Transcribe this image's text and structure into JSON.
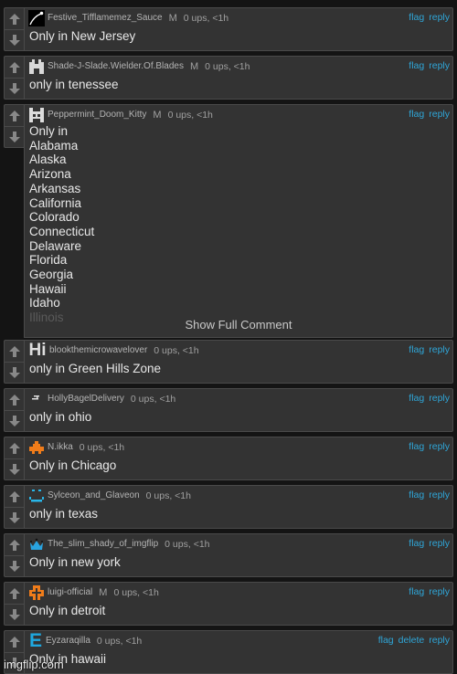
{
  "colors": {
    "link": "#2fa6d8",
    "background": "#141414",
    "card": "#333333"
  },
  "comments": [
    {
      "user": "Festive_Tifflamemez_Sauce",
      "mod": "M",
      "meta": "0 ups, <1h",
      "text": "Only in New Jersey",
      "avatar": "shooting-star-avatar",
      "actions": [
        "flag",
        "reply"
      ]
    },
    {
      "user": "Shade-J-Slade.Wielder.Of.Blades",
      "mod": "M",
      "meta": "0 ups, <1h",
      "text": "only in tenessee",
      "avatar": "floppy-disk-avatar",
      "actions": [
        "flag",
        "reply"
      ]
    },
    {
      "user": "Peppermint_Doom_Kitty",
      "mod": "M",
      "meta": "0 ups, <1h",
      "lines": [
        "Only in",
        "Alabama",
        "Alaska",
        "Arizona",
        "Arkansas",
        "California",
        "Colorado",
        "Connecticut",
        "Delaware",
        "Florida",
        "Georgia",
        "Hawaii",
        "Idaho"
      ],
      "faded_line": "Illinois",
      "show_full": "Show Full Comment",
      "avatar": "pixel-cat-avatar",
      "actions": [
        "flag",
        "reply"
      ]
    },
    {
      "user": "blookthemicrowavelover",
      "meta": "0 ups, <1h",
      "text": "only in Green Hills Zone",
      "avatar": "hi-text-avatar",
      "avatar_text": "Hi",
      "actions": [
        "flag",
        "reply"
      ]
    },
    {
      "user": "HollyBagelDelivery",
      "meta": "0 ups, <1h",
      "text": "only in ohio",
      "avatar": "small-glyph-avatar",
      "actions": [
        "flag",
        "reply"
      ]
    },
    {
      "user": "N.ikka",
      "meta": "0 ups, <1h",
      "text": "Only in Chicago",
      "avatar": "orange-pixel-avatar",
      "actions": [
        "flag",
        "reply"
      ]
    },
    {
      "user": "Sylceon_and_Glaveon",
      "meta": "0 ups, <1h",
      "text": "only in texas",
      "avatar": "blue-smiley-avatar",
      "actions": [
        "flag",
        "reply"
      ]
    },
    {
      "user": "The_slim_shady_of_imgflip",
      "meta": "0 ups, <1h",
      "text": "Only in new york",
      "avatar": "blue-crown-avatar",
      "actions": [
        "flag",
        "reply"
      ]
    },
    {
      "user": "luigi-official",
      "mod": "M",
      "meta": "0 ups, <1h",
      "text": "Only in detroit",
      "avatar": "orange-block-avatar",
      "actions": [
        "flag",
        "reply"
      ]
    },
    {
      "user": "Eyzaraqilla",
      "meta": "0 ups, <1h",
      "text": "Only in hawaii",
      "avatar": "blue-e-avatar",
      "avatar_text": "E",
      "actions": [
        "flag",
        "delete",
        "reply"
      ]
    }
  ],
  "watermark": "imgflip.com"
}
